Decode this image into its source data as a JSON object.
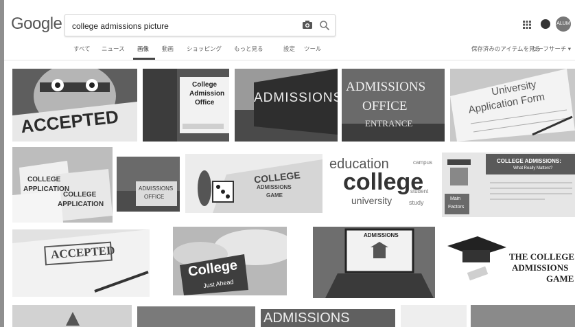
{
  "header": {
    "logo": "Google",
    "search_query": "college admissions picture",
    "avatar_initials": "ALUM"
  },
  "nav": {
    "tabs": [
      "すべて",
      "ニュース",
      "画像",
      "動画",
      "ショッピング",
      "もっと見る"
    ],
    "active_tab": "画像",
    "settings": "設定",
    "tools": "ツール",
    "saved_items": "保存済みのアイテムを見る",
    "safesearch": "セーフサーチ ▾"
  },
  "images": {
    "accepted": "ACCEPTED",
    "admission_office": [
      "College",
      "Admission",
      "Office"
    ],
    "admissions_sign": "ADMISSIONS",
    "admissions_office": [
      "ADMISSIONS",
      "OFFICE",
      "ENTRANCE"
    ],
    "application_form": [
      "University",
      "Application Form"
    ],
    "college_application": [
      "COLLEGE",
      "APPLICATION"
    ],
    "admissions_office_sign": [
      "ADMISSIONS",
      "OFFICE"
    ],
    "game_board": [
      "COLLEGE",
      "ADMISSIONS",
      "GAME"
    ],
    "word_cloud": [
      "education",
      "college",
      "university",
      "study",
      "student",
      "campus"
    ],
    "infographic": [
      "COLLEGE ADMISSIONS:",
      "What Really Matters?",
      "Main",
      "Factors"
    ],
    "accepted_stamp": "ACCEPTED",
    "road_sign": [
      "College",
      "Just Ahead"
    ],
    "laptop": "ADMISSIONS",
    "grad_game": [
      "THE COLLEGE",
      "ADMISSIONS",
      "GAME"
    ],
    "bottom_row": "ADMISSIONS"
  }
}
